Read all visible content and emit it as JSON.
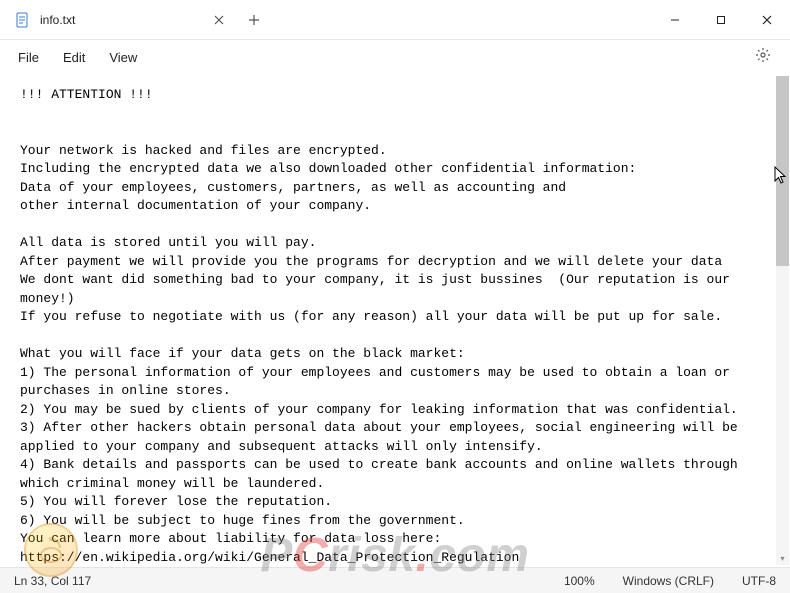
{
  "tab": {
    "title": "info.txt"
  },
  "menubar": {
    "file": "File",
    "edit": "Edit",
    "view": "View"
  },
  "content": {
    "text": "!!! ATTENTION !!!\n\n\nYour network is hacked and files are encrypted.\nIncluding the encrypted data we also downloaded other confidential information:\nData of your employees, customers, partners, as well as accounting and\nother internal documentation of your company.\n\nAll data is stored until you will pay.\nAfter payment we will provide you the programs for decryption and we will delete your data\nWe dont want did something bad to your company, it is just bussines  (Our reputation is our money!)\nIf you refuse to negotiate with us (for any reason) all your data will be put up for sale.\n\nWhat you will face if your data gets on the black market:\n1) The personal information of your employees and customers may be used to obtain a loan or\npurchases in online stores.\n2) You may be sued by clients of your company for leaking information that was confidential.\n3) After other hackers obtain personal data about your employees, social engineering will be\napplied to your company and subsequent attacks will only intensify.\n4) Bank details and passports can be used to create bank accounts and online wallets through\nwhich criminal money will be laundered.\n5) You will forever lose the reputation.\n6) You will be subject to huge fines from the government.\nYou can learn more about liability for data loss here:\nhttps://en.wikipedia.org/wiki/General_Data_Protection_Regulation\nhttps://gdpr-info.eu/\nCourts, fines and the inability to use important files will lead you to huge losses.\nThe consequences of this will be irreversible for you.\nContacting the police will not save you from these consequences, and lost data,"
  },
  "statusbar": {
    "position": "Ln 33, Col 117",
    "zoom": "100%",
    "eol": "Windows (CRLF)",
    "encoding": "UTF-8"
  },
  "watermark": {
    "p": "P",
    "c": "C",
    "rest": "risk",
    "dot": ".",
    "com": "com"
  }
}
